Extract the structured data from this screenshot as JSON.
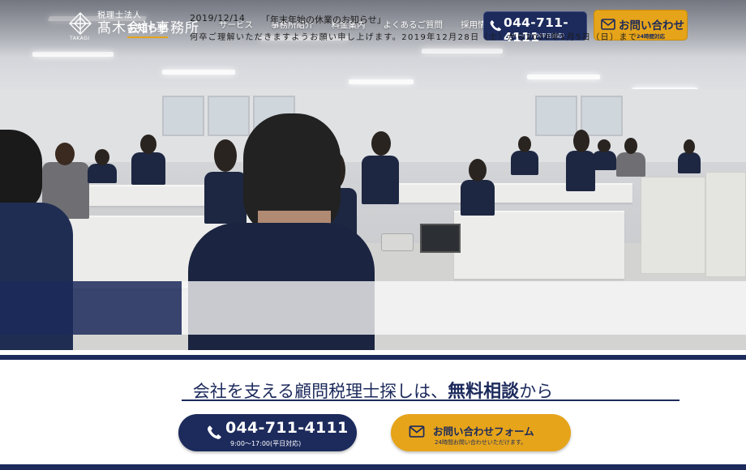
{
  "header": {
    "logo_corp": "税理士法人",
    "logo_name": "髙木会計事務所",
    "logo_sub": "TAKAGI",
    "nav": [
      "サービス",
      "事務所紹介",
      "料金案内",
      "よくあるご質問",
      "採用情報"
    ],
    "tel": {
      "number": "044-711-4111",
      "hours": "9:00〜17:00(平日対応)",
      "icon": "phone-icon"
    },
    "mail": {
      "label": "お問い合わせ",
      "sub": "24時間対応",
      "icon": "envelope-icon"
    }
  },
  "news": {
    "label": "お知らせ",
    "date": "2019/12/14",
    "title": "「年末年始の休業のお知らせ」",
    "text": "何卒ご理解いただきますようお願い申し上げます。2019年12月28日（土）から2020年1月5日（日）まで"
  },
  "cta": {
    "heading_pre": "会社を支える顧問税理士探しは、",
    "heading_strong": "無料相談",
    "heading_post": "から",
    "tel": {
      "number": "044-711-4111",
      "hours": "9:00〜17:00(平日対応)"
    },
    "mail": {
      "label": "お問い合わせフォーム",
      "sub": "24時間お問い合わせいただけます。"
    }
  },
  "colors": {
    "navy": "#1c2a5c",
    "gold": "#e6a41a"
  }
}
